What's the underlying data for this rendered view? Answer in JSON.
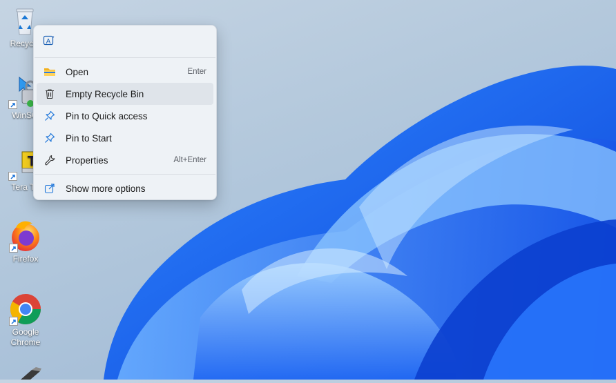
{
  "desktop": {
    "icons": [
      {
        "label": "Recycle",
        "icon": "recycle-bin-icon"
      },
      {
        "label": "WinSC",
        "icon": "winscp-icon"
      },
      {
        "label": "Tera Te",
        "icon": "tera-term-icon"
      },
      {
        "label": "Firefox",
        "icon": "firefox-icon"
      },
      {
        "label": "Google Chrome",
        "icon": "chrome-icon"
      }
    ]
  },
  "context_menu": {
    "top_icon": "ai-rewrite-icon",
    "items": [
      {
        "label": "Open",
        "accel": "Enter",
        "icon": "folder-icon"
      },
      {
        "label": "Empty Recycle Bin",
        "accel": "",
        "icon": "trash-icon"
      },
      {
        "label": "Pin to Quick access",
        "accel": "",
        "icon": "pin-icon"
      },
      {
        "label": "Pin to Start",
        "accel": "",
        "icon": "pin-icon"
      },
      {
        "label": "Properties",
        "accel": "Alt+Enter",
        "icon": "wrench-icon"
      }
    ],
    "more_options": {
      "label": "Show more options",
      "icon": "share-icon"
    }
  },
  "colors": {
    "accent": "#0a63d6",
    "wallpaper_bloom": "#1f6dfa"
  }
}
